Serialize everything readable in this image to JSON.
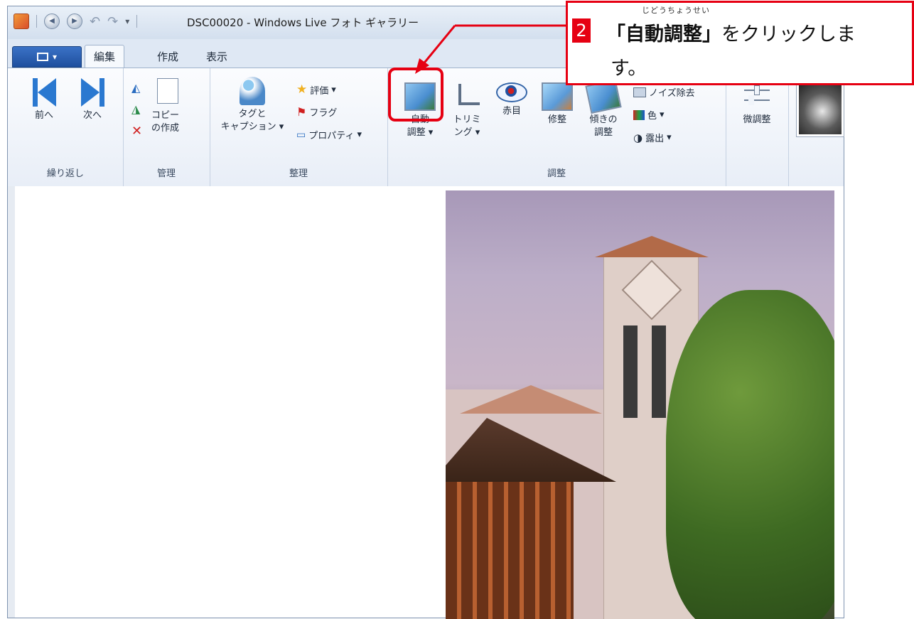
{
  "window": {
    "title": "DSC00020 - Windows Live フォト ギャラリー"
  },
  "tabs": [
    {
      "label": "編集",
      "active": true
    },
    {
      "label": "作成",
      "active": false
    },
    {
      "label": "表示",
      "active": false
    }
  ],
  "ribbon": {
    "groups": {
      "navigate": {
        "label": "繰り返し",
        "prev_label": "前へ",
        "next_label": "次へ"
      },
      "manage": {
        "label": "管理",
        "copy_line1": "コピー",
        "copy_line2": "の作成"
      },
      "organize": {
        "label": "整理",
        "tag_line1": "タグと",
        "tag_line2": "キャプション",
        "rating": "評価",
        "flag": "フラグ",
        "properties": "プロパティ"
      },
      "adjust": {
        "label": "調整",
        "auto_line1": "自動",
        "auto_line2": "調整",
        "crop_line1": "トリミ",
        "crop_line2": "ング",
        "redeye": "赤目",
        "retouch": "修整",
        "straighten_line1": "傾きの",
        "straighten_line2": "調整",
        "noise": "ノイズ除去",
        "color": "色",
        "exposure": "露出"
      },
      "fine": {
        "label": "微調整"
      }
    }
  },
  "callout": {
    "step": "2",
    "ruby": "じどうちょうせい",
    "open_bracket": "「",
    "keyword": "自動調整",
    "close_bracket": "」",
    "text_after": "をクリックしま",
    "text_line2": "す。"
  },
  "colors": {
    "callout_red": "#e60012",
    "ribbon_blue": "#2a78d0"
  }
}
